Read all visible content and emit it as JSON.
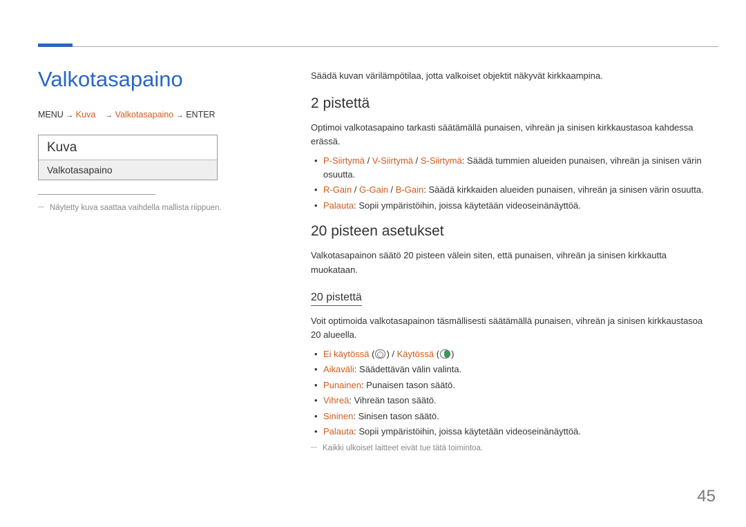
{
  "page_title": "Valkotasapaino",
  "breadcrumb": {
    "menu": "MENU",
    "arrow": "→",
    "kuva": "Kuva",
    "valko": "Valkotasapaino",
    "enter": "ENTER"
  },
  "panel": {
    "header": "Kuva",
    "item": "Valkotasapaino"
  },
  "left_footnote": "Näytetty kuva saattaa vaihdella mallista riippuen.",
  "intro": "Säädä kuvan värilämpötilaa, jotta valkoiset objektit näkyvät kirkkaampina.",
  "sec1": {
    "heading": "2 pistettä",
    "desc": "Optimoi valkotasapaino tarkasti säätämällä punaisen, vihreän ja sinisen kirkkaustasoa kahdessa erässä.",
    "items": [
      {
        "p1": "P-Siirtymä",
        "p2": "V-Siirtymä",
        "p3": "S-Siirtymä",
        "rest": ": Säädä tummien alueiden punaisen, vihreän ja sinisen värin osuutta."
      },
      {
        "p1": "R-Gain",
        "p2": "G-Gain",
        "p3": "B-Gain",
        "rest": ": Säädä kirkkaiden alueiden punaisen, vihreän ja sinisen värin osuutta."
      },
      {
        "p1": "Palauta",
        "rest": ": Sopii ympäristöihin, joissa käytetään videoseinänäyttöä."
      }
    ]
  },
  "sec2": {
    "heading": "20 pisteen asetukset",
    "desc": "Valkotasapainon säätö 20 pisteen välein siten, että punaisen, vihreän ja sinisen kirkkautta muokataan.",
    "sub_heading": "20 pistettä",
    "sub_desc": "Voit optimoida valkotasapainon täsmällisesti säätämällä punaisen, vihreän ja sinisen kirkkaustasoa 20 alueella.",
    "items": [
      {
        "hl": "Ei käytössä",
        "mid": " / ",
        "hl2": "Käytössä"
      },
      {
        "hl": "Aikaväli",
        "rest": ": Säädettävän välin valinta."
      },
      {
        "hl": "Punainen",
        "rest": ": Punaisen tason säätö."
      },
      {
        "hl": "Vihreä",
        "rest": ": Vihreän tason säätö."
      },
      {
        "hl": "Sininen",
        "rest": ": Sinisen tason säätö."
      },
      {
        "hl": "Palauta",
        "rest": ": Sopii ympäristöihin, joissa käytetään videoseinänäyttöä."
      }
    ],
    "footnote": "Kaikki ulkoiset laitteet eivät tue tätä toimintoa."
  },
  "page_number": "45"
}
